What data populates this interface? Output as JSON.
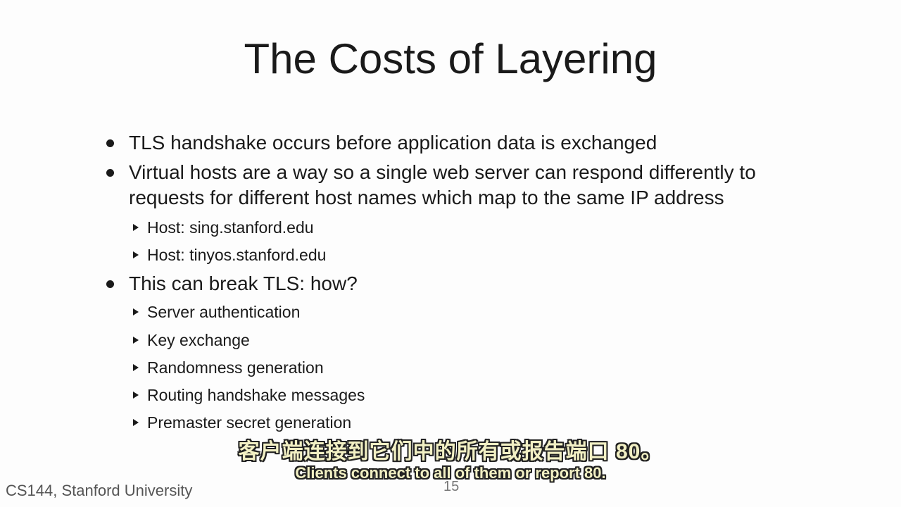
{
  "slide": {
    "title": "The Costs of Layering",
    "bullets": [
      "TLS handshake occurs before application data is exchanged",
      "Virtual hosts are a way so a single web server can respond differently to",
      "requests for different host names which map to the same IP address",
      "This can break TLS: how?"
    ],
    "sub_bullets_hosts": [
      "Host: sing.stanford.edu",
      "Host: tinyos.stanford.edu"
    ],
    "sub_bullets_how": [
      "Server authentication",
      "Key exchange",
      "Randomness generation",
      "Routing handshake messages",
      "Premaster secret generation"
    ],
    "footer": "CS144, Stanford University",
    "page_number": "15"
  },
  "subtitles": {
    "chinese": "客户端连接到它们中的所有或报告端口 80。",
    "english": "Clients connect to all of them or report 80.",
    "color": "#f2f0c4"
  }
}
